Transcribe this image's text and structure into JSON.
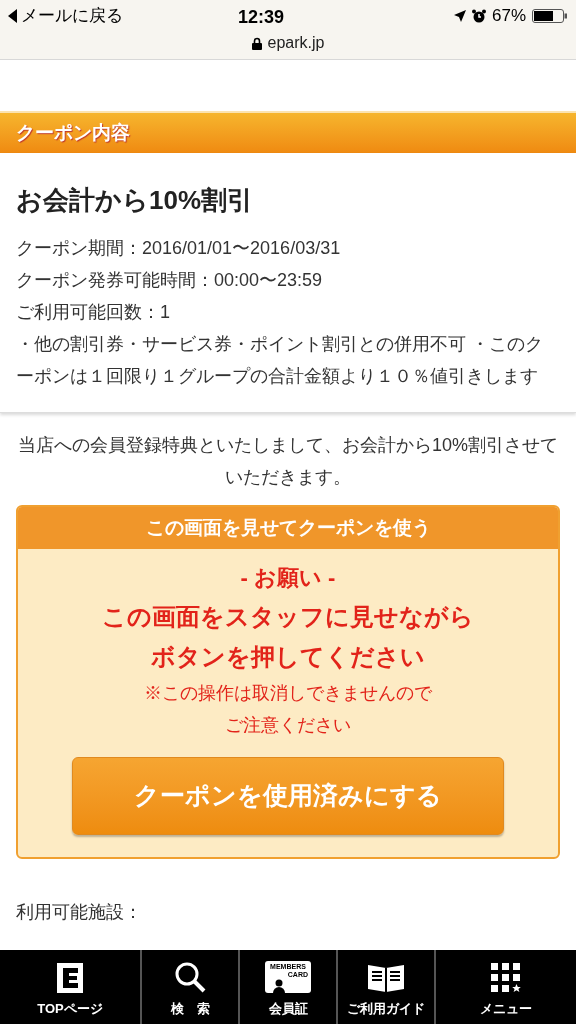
{
  "status_bar": {
    "back": "メールに戻る",
    "time": "12:39",
    "battery": "67%",
    "url": "epark.jp"
  },
  "section_header": "クーポン内容",
  "coupon": {
    "title": "お会計から10%割引",
    "details": [
      "クーポン期間：2016/01/01〜2016/03/31",
      "クーポン発券可能時間：00:00〜23:59",
      "ご利用可能回数：1",
      "・他の割引券・サービス券・ポイント割引との併用不可 ・このクーポンは１回限り１グループの合計金額より１０％値引きします"
    ]
  },
  "description": "当店への会員登録特典といたしまして、お会計から10%割引させていただきます。",
  "use_panel": {
    "title": "この画面を見せてクーポンを使う",
    "request_heading": "- お願い -",
    "request": [
      "この画面をスタッフに見せながら",
      "ボタンを押してください"
    ],
    "note": [
      "※この操作は取消しできませんので",
      "ご注意ください"
    ],
    "button": "クーポンを使用済みにする"
  },
  "facilities_label": "利用可能施設：",
  "bottom_nav": [
    {
      "kind": "top",
      "label": "TOPページ"
    },
    {
      "kind": "search",
      "label": "検　索"
    },
    {
      "kind": "card",
      "label": "会員証",
      "icon_text": [
        "MEMBERS",
        "CARD"
      ]
    },
    {
      "kind": "guide",
      "label": "ご利用ガイド"
    },
    {
      "kind": "menu",
      "label": "メニュー"
    }
  ]
}
